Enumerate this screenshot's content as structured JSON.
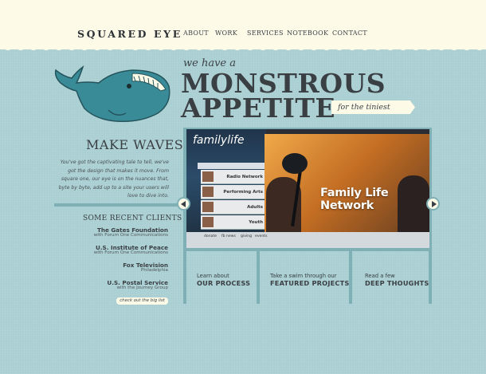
{
  "header": {
    "logo": "SQUARED EYE",
    "nav": [
      "ABOUT",
      "WORK",
      "SERVICES",
      "NOTEBOOK",
      "CONTACT"
    ]
  },
  "hero": {
    "tagline": "we have a",
    "headline_line1": "MONSTROUS",
    "headline_line2": "APPETITE",
    "ribbon": "for the tiniest details"
  },
  "intro": {
    "title": "MAKE WAVES!",
    "body": "You've got the captivating tale to tell, we've got the design that makes it move. From square one, our eye is on the nuances that, byte by byte, add up to a site your users will love to dive into."
  },
  "clients": {
    "title": "SOME RECENT CLIENTS",
    "items": [
      {
        "name": "The Gates Foundation",
        "sub": "with Forum One Communications"
      },
      {
        "name": "U.S. Institute of Peace",
        "sub": "with Forum One Communications"
      },
      {
        "name": "Fox Television",
        "sub": "Philadelphia"
      },
      {
        "name": "U.S. Postal Service",
        "sub": "with the Journey Group"
      }
    ],
    "link": "check out the big list"
  },
  "slide": {
    "logo": "familylife",
    "menu": [
      "Radio Network",
      "Performing Arts",
      "Adults",
      "Youth"
    ],
    "title": "Family Life Network",
    "footer": [
      "donate",
      "fb news",
      "giving",
      "events"
    ]
  },
  "columns": [
    {
      "small": "Learn about",
      "big": "OUR PROCESS"
    },
    {
      "small": "Take a swim through our",
      "big": "FEATURED PROJECTS"
    },
    {
      "small": "Read a few",
      "big": "DEEP THOUGHTS"
    }
  ],
  "colors": {
    "background": "#a9cfd2",
    "header": "#fdfbe8",
    "accent": "#7fb0b5",
    "text": "#3a3f44",
    "whale": "#3a8b98"
  }
}
